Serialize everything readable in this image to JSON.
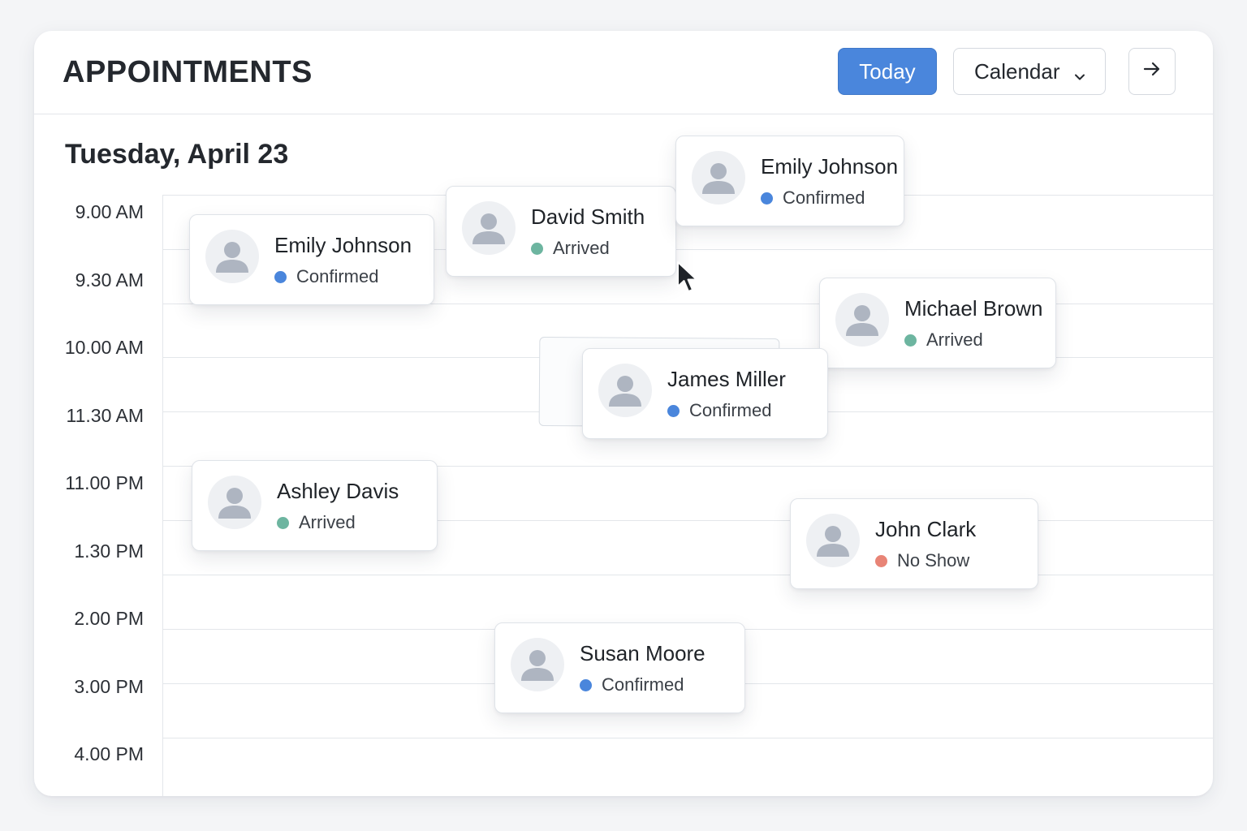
{
  "header": {
    "title": "APPOINTMENTS",
    "today_label": "Today",
    "view_select": "Calendar",
    "next_icon": "arrow-right-icon",
    "dropdown_icon": "chevron-down-icon"
  },
  "date_label": "Tuesday, April 23",
  "times": [
    "9.00 AM",
    "9.30 AM",
    "10.00 AM",
    "11.30 AM",
    "11.00 PM",
    "1.30 PM",
    "2.00 PM",
    "3.00 PM",
    "4.00 PM"
  ],
  "status_colors": {
    "Confirmed": "#4a86dc",
    "Arrived": "#6db5a0",
    "No Show": "#e88476"
  },
  "accent_color": "#4a86dc",
  "appointments": [
    {
      "name": "Emily Johnson",
      "status": "Confirmed",
      "icon": "user-avatar-icon"
    },
    {
      "name": "David Smith",
      "status": "Arrived",
      "icon": "user-avatar-icon"
    },
    {
      "name": "Emily Johnson",
      "status": "Confirmed",
      "icon": "user-avatar-icon"
    },
    {
      "name": "Michael Brown",
      "status": "Arrived",
      "icon": "user-avatar-icon"
    },
    {
      "name": "James Miller",
      "status": "Confirmed",
      "icon": "user-avatar-icon"
    },
    {
      "name": "Ashley Davis",
      "status": "Arrived",
      "icon": "user-avatar-icon"
    },
    {
      "name": "John Clark",
      "status": "No Show",
      "icon": "user-avatar-icon"
    },
    {
      "name": "Susan Moore",
      "status": "Confirmed",
      "icon": "user-avatar-icon"
    }
  ]
}
